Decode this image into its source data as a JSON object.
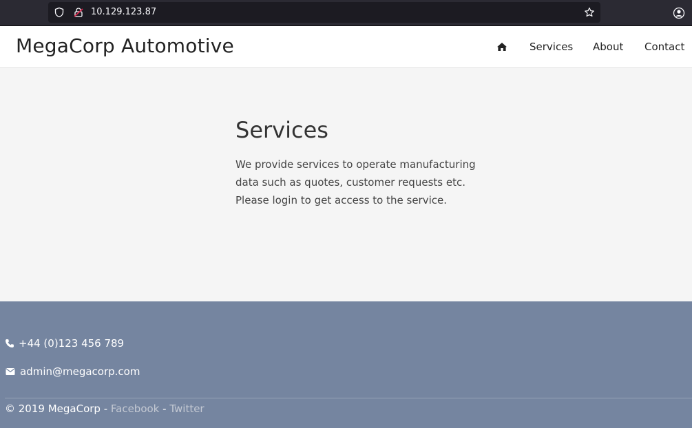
{
  "browser": {
    "url": "10.129.123.87",
    "icons": [
      "shield-icon",
      "lock-icon",
      "star-icon",
      "account-icon"
    ]
  },
  "header": {
    "brand": "MegaCorp Automotive",
    "nav": {
      "home_icon": "home-icon",
      "services": "Services",
      "about": "About",
      "contact": "Contact"
    }
  },
  "main": {
    "title": "Services",
    "body": "We provide services to operate manufacturing data such as quotes, customer requests etc. Please login to get access to the service."
  },
  "footer": {
    "phone": "+44 (0)123 456 789",
    "email": "admin@megacorp.com",
    "copyright": "© 2019 MegaCorp - ",
    "facebook": "Facebook",
    "separator": " - ",
    "twitter": "Twitter"
  },
  "colors": {
    "footer_bg": "#7585a0",
    "link_muted": "#c4c9d3",
    "browser_dark": "#2b2a33"
  }
}
